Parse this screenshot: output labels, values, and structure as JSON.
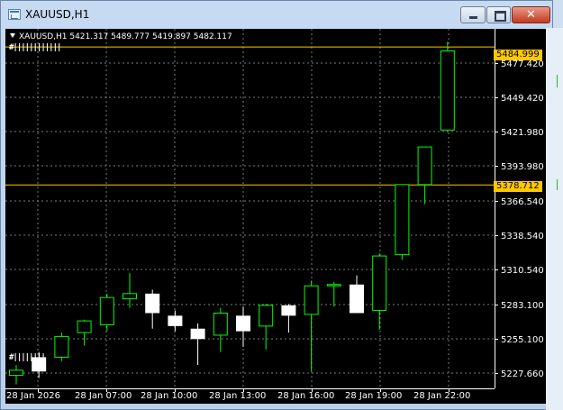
{
  "window": {
    "title": "XAUUSD,H1",
    "close_label": "✕"
  },
  "chart": {
    "info": "XAUUSD,H1  5421.317 5489.777 5419.897 5482.117",
    "price_tags": [
      {
        "value": "5484.999"
      },
      {
        "value": "5378.712"
      }
    ],
    "y_labels": [
      "5477.420",
      "5449.420",
      "5421.980",
      "5393.980",
      "5366.540",
      "5338.540",
      "5310.540",
      "5283.100",
      "5255.100",
      "5227.660"
    ],
    "x_labels": [
      "28 Jan 2026",
      "28 Jan 07:00",
      "28 Jan 10:00",
      "28 Jan 13:00",
      "28 Jan 16:00",
      "28 Jan 19:00",
      "28 Jan 22:00"
    ],
    "colors": {
      "bull": "#00ff00",
      "bear": "#ffffff",
      "grid": "#7a7a7a",
      "level": "#ffc800",
      "background": "#000000"
    }
  },
  "chart_data": {
    "type": "candlestick",
    "ylim": [
      5222,
      5499
    ],
    "candles": [
      {
        "o": 5232,
        "h": 5240,
        "l": 5225,
        "c": 5236
      },
      {
        "o": 5246,
        "h": 5250,
        "l": 5230,
        "c": 5235
      },
      {
        "o": 5246,
        "h": 5265,
        "l": 5243,
        "c": 5262
      },
      {
        "o": 5265,
        "h": 5275,
        "l": 5255,
        "c": 5274
      },
      {
        "o": 5271,
        "h": 5295,
        "l": 5266,
        "c": 5292
      },
      {
        "o": 5291,
        "h": 5311,
        "l": 5284,
        "c": 5295
      },
      {
        "o": 5295,
        "h": 5298,
        "l": 5268,
        "c": 5280
      },
      {
        "o": 5278,
        "h": 5282,
        "l": 5266,
        "c": 5270
      },
      {
        "o": 5268,
        "h": 5272,
        "l": 5240,
        "c": 5260
      },
      {
        "o": 5263,
        "h": 5284,
        "l": 5250,
        "c": 5280
      },
      {
        "o": 5278,
        "h": 5285,
        "l": 5254,
        "c": 5266
      },
      {
        "o": 5270,
        "h": 5287,
        "l": 5252,
        "c": 5286
      },
      {
        "o": 5286,
        "h": 5287,
        "l": 5265,
        "c": 5278
      },
      {
        "o": 5279,
        "h": 5305,
        "l": 5235,
        "c": 5301
      },
      {
        "o": 5301,
        "h": 5304,
        "l": 5285,
        "c": 5302
      },
      {
        "o": 5302,
        "h": 5309,
        "l": 5288,
        "c": 5280
      },
      {
        "o": 5282,
        "h": 5326,
        "l": 5267,
        "c": 5324
      },
      {
        "o": 5325,
        "h": 5343,
        "l": 5321,
        "c": 5379
      },
      {
        "o": 5379,
        "h": 5396,
        "l": 5364,
        "c": 5408
      },
      {
        "o": 5421,
        "h": 5489,
        "l": 5420,
        "c": 5482
      }
    ],
    "levels": [
      5484.999,
      5378.712
    ]
  }
}
